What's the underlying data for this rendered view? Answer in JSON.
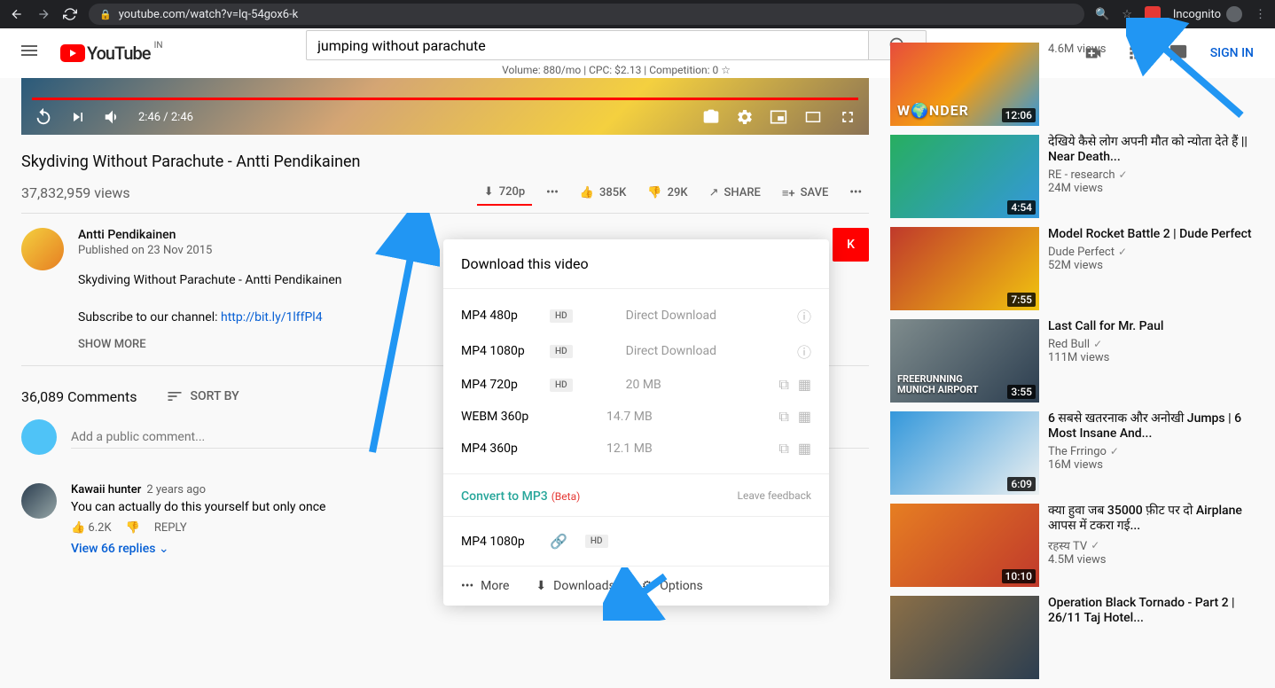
{
  "browser": {
    "url": "youtube.com/watch?v=lq-54gox6-k",
    "incognito_label": "Incognito"
  },
  "header": {
    "logo_text": "YouTube",
    "region": "IN",
    "search_value": "jumping without parachute",
    "seo_line": "Volume: 880/mo | CPC: $2.13 | Competition: 0 ☆",
    "sign_in": "SIGN IN"
  },
  "player": {
    "time": "2:46 / 2:46"
  },
  "video": {
    "title": "Skydiving Without Parachute - Antti Pendikainen",
    "views": "37,832,959 views",
    "download_quality": "720p",
    "likes": "385K",
    "dislikes": "29K",
    "share": "SHARE",
    "save": "SAVE"
  },
  "channel": {
    "name": "Antti Pendikainen",
    "published": "Published on 23 Nov 2015",
    "desc1": "Skydiving Without Parachute - Antti Pendikainen",
    "desc2_prefix": "Subscribe to our channel: ",
    "desc2_link": "http://bit.ly/1lffPl4",
    "show_more": "SHOW MORE",
    "subscribe_suffix": "K"
  },
  "comments": {
    "count": "36,089 Comments",
    "sort": "SORT BY",
    "placeholder": "Add a public comment...",
    "c1": {
      "author": "Kawaii hunter",
      "time": "2 years ago",
      "text": "You can actually do this yourself but only once",
      "likes": "6.2K",
      "reply": "REPLY",
      "view_replies": "View 66 replies"
    }
  },
  "popup": {
    "title": "Download this video",
    "rows": [
      {
        "format": "MP4 480p",
        "hd": true,
        "info": "Direct Download",
        "info_icon": true
      },
      {
        "format": "MP4 1080p",
        "hd": true,
        "info": "Direct Download",
        "info_icon": true
      },
      {
        "format": "MP4 720p",
        "hd": true,
        "info": "20 MB",
        "copy": true
      },
      {
        "format": "WEBM 360p",
        "hd": false,
        "info": "14.7 MB",
        "copy": true
      },
      {
        "format": "MP4 360p",
        "hd": false,
        "info": "12.1 MB",
        "copy": true
      }
    ],
    "convert": "Convert to MP3",
    "beta": "(Beta)",
    "feedback": "Leave feedback",
    "extra_format": "MP4 1080p",
    "footer": {
      "more": "More",
      "downloads": "Downloads",
      "options": "Options"
    }
  },
  "related": [
    {
      "title_prefix": "",
      "views": "4.6M views",
      "time": "12:06",
      "channel": ""
    },
    {
      "title": "देखिये कैसे लोग अपनी मौत को न्योता देते हैं || Near Death...",
      "channel": "RE - research",
      "views": "24M views",
      "time": "4:54"
    },
    {
      "title": "Model Rocket Battle 2 | Dude Perfect",
      "channel": "Dude Perfect",
      "views": "52M views",
      "time": "7:55"
    },
    {
      "title": "Last Call for Mr. Paul",
      "channel": "Red Bull",
      "views": "111M views",
      "time": "3:55"
    },
    {
      "title": "6 सबसे खतरनाक और अनोखी Jumps | 6 Most Insane And...",
      "channel": "The Frringo",
      "views": "16M views",
      "time": "6:09"
    },
    {
      "title": "क्या हुवा जब 35000 फ़ीट पर दो Airplane आपस में टकरा गई...",
      "channel": "रहस्य TV",
      "views": "4.5M views",
      "time": "10:10"
    },
    {
      "title": "Operation Black Tornado - Part 2 | 26/11 Taj Hotel...",
      "channel": "",
      "views": "",
      "time": ""
    }
  ]
}
